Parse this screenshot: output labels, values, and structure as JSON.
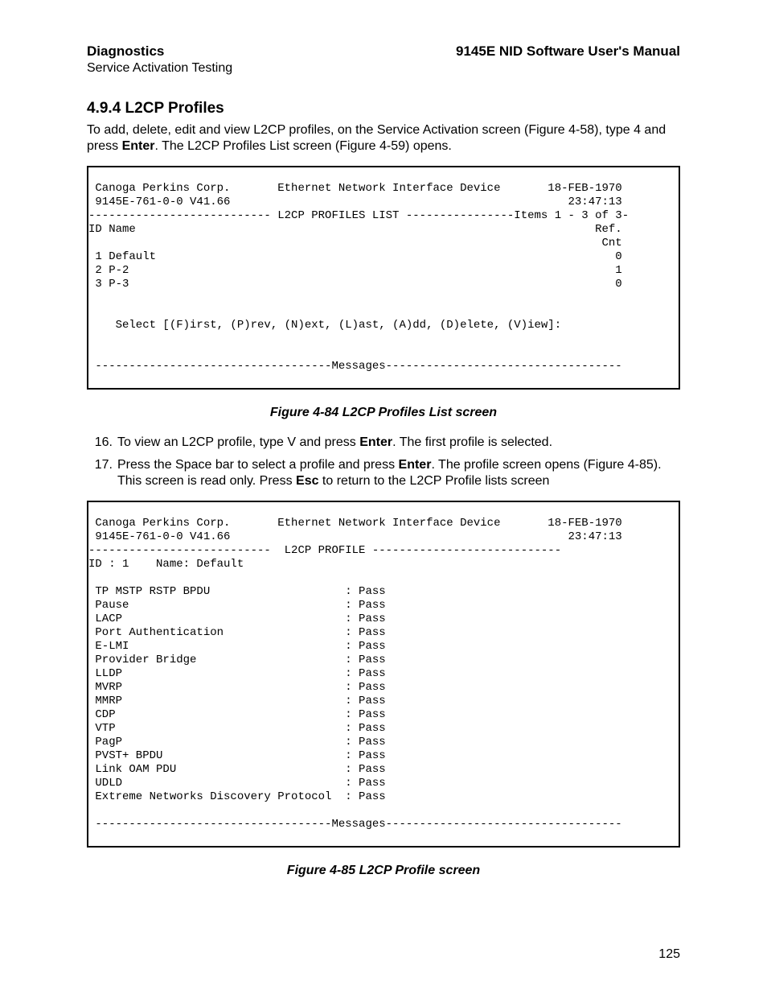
{
  "header": {
    "left_top": "Diagnostics",
    "left_bottom": "Service Activation Testing",
    "right": "9145E NID Software User's Manual"
  },
  "section": {
    "number": "4.9.4",
    "title": "L2CP Profiles"
  },
  "intro": {
    "p1a": "To add, delete, edit and view  L2CP profiles, on the  Service Activation screen (Figure 4-58), type 4 and press ",
    "p1_bold": "Enter",
    "p1b": ".   The L2CP Profiles List  screen (Figure 4-59) opens."
  },
  "terminal1": {
    "corp": "Canoga Perkins Corp.",
    "device": "Ethernet Network Interface Device",
    "date": "18-FEB-1970",
    "model": "9145E-761-0-0 V41.66",
    "time": "23:47:13",
    "list_title": "L2CP PROFILES LIST",
    "items_range": "Items 1 - 3 of 3",
    "cols": {
      "id": "ID",
      "name": "Name",
      "ref": "Ref.",
      "cnt": "Cnt"
    },
    "rows": [
      {
        "id": "1",
        "name": "Default",
        "cnt": "0"
      },
      {
        "id": "2",
        "name": "P-2",
        "cnt": "1"
      },
      {
        "id": "3",
        "name": "P-3",
        "cnt": "0"
      }
    ],
    "prompt": "Select [(F)irst, (P)rev, (N)ext, (L)ast, (A)dd, (D)elete, (V)iew]:",
    "messages_label": "Messages"
  },
  "fig84": "Figure 4-84  L2CP Profiles List screen",
  "list": {
    "i16": {
      "num": "16.",
      "a": "To view an L2CP profile, type V and press ",
      "bold": "Enter",
      "b": ". The first profile is selected."
    },
    "i17": {
      "num": "17.",
      "a": "Press the Space bar to select a profile and press ",
      "bold1": "Enter",
      "b": ". The profile screen opens (Figure 4-85). This screen is read only.  Press ",
      "bold2": "Esc",
      "c": " to return to the L2CP Profile lists screen"
    }
  },
  "terminal2": {
    "corp": "Canoga Perkins Corp.",
    "device": "Ethernet Network Interface Device",
    "date": "18-FEB-1970",
    "model": "9145E-761-0-0 V41.66",
    "time": "23:47:13",
    "profile_title": "L2CP PROFILE",
    "id_label": "ID : 1",
    "name_label": "Name: Default",
    "fields": [
      {
        "k": "TP MSTP RSTP BPDU",
        "v": "Pass"
      },
      {
        "k": "Pause",
        "v": "Pass"
      },
      {
        "k": "LACP",
        "v": "Pass"
      },
      {
        "k": "Port Authentication",
        "v": "Pass"
      },
      {
        "k": "E-LMI",
        "v": "Pass"
      },
      {
        "k": "Provider Bridge",
        "v": "Pass"
      },
      {
        "k": "LLDP",
        "v": "Pass"
      },
      {
        "k": "MVRP",
        "v": "Pass"
      },
      {
        "k": "MMRP",
        "v": "Pass"
      },
      {
        "k": "CDP",
        "v": "Pass"
      },
      {
        "k": "VTP",
        "v": "Pass"
      },
      {
        "k": "PagP",
        "v": "Pass"
      },
      {
        "k": "PVST+ BPDU",
        "v": "Pass"
      },
      {
        "k": "Link OAM PDU",
        "v": "Pass"
      },
      {
        "k": "UDLD",
        "v": "Pass"
      },
      {
        "k": "Extreme Networks Discovery Protocol",
        "v": "Pass"
      }
    ],
    "messages_label": "Messages"
  },
  "fig85": "Figure 4-85  L2CP Profile screen",
  "page_number": "125"
}
